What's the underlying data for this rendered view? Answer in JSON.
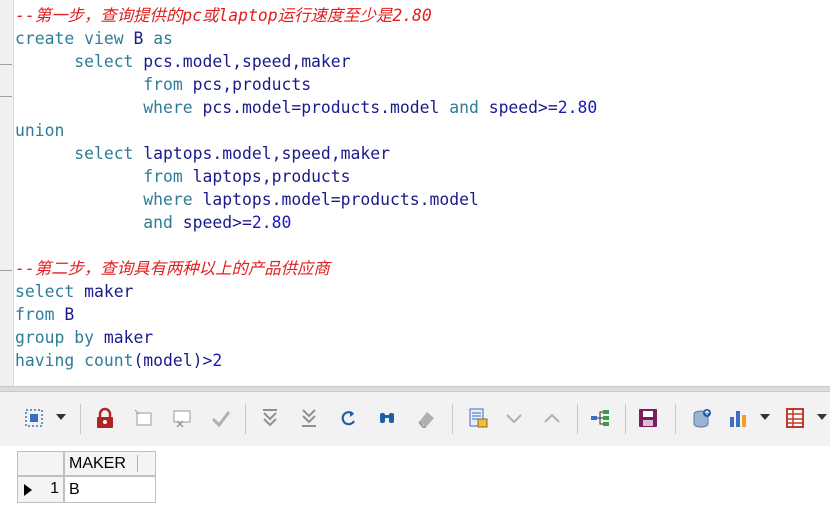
{
  "editor": {
    "lines": [
      {
        "indent": "",
        "parts": [
          {
            "t": "--第一步，查询提供的pc或laptop运行速度至少是2.80",
            "c": "cm"
          }
        ]
      },
      {
        "indent": "",
        "parts": [
          {
            "t": "create",
            "c": "kw"
          },
          {
            "t": " ",
            "c": "pl"
          },
          {
            "t": "view",
            "c": "kw"
          },
          {
            "t": " B ",
            "c": "id"
          },
          {
            "t": "as",
            "c": "kw"
          }
        ]
      },
      {
        "indent": "      ",
        "parts": [
          {
            "t": "select",
            "c": "kw"
          },
          {
            "t": " pcs.model,speed,maker",
            "c": "id"
          }
        ]
      },
      {
        "indent": "             ",
        "parts": [
          {
            "t": "from",
            "c": "kw"
          },
          {
            "t": " pcs,products",
            "c": "id"
          }
        ]
      },
      {
        "indent": "             ",
        "parts": [
          {
            "t": "where",
            "c": "kw"
          },
          {
            "t": " pcs.model=products.model ",
            "c": "id"
          },
          {
            "t": "and",
            "c": "kw"
          },
          {
            "t": " speed>=",
            "c": "id"
          },
          {
            "t": "2.80",
            "c": "num"
          }
        ]
      },
      {
        "indent": "",
        "parts": [
          {
            "t": "union",
            "c": "kw"
          }
        ]
      },
      {
        "indent": "      ",
        "parts": [
          {
            "t": "select",
            "c": "kw"
          },
          {
            "t": " laptops.model,speed,maker",
            "c": "id"
          }
        ]
      },
      {
        "indent": "             ",
        "parts": [
          {
            "t": "from",
            "c": "kw"
          },
          {
            "t": " laptops,products",
            "c": "id"
          }
        ]
      },
      {
        "indent": "             ",
        "parts": [
          {
            "t": "where",
            "c": "kw"
          },
          {
            "t": " laptops.model=products.model",
            "c": "id"
          }
        ]
      },
      {
        "indent": "             ",
        "parts": [
          {
            "t": "and",
            "c": "kw"
          },
          {
            "t": " speed>=",
            "c": "id"
          },
          {
            "t": "2.80",
            "c": "num"
          }
        ]
      },
      {
        "indent": "",
        "parts": []
      },
      {
        "indent": "",
        "parts": [
          {
            "t": "--第二步，查询具有两种以上的产品供应商",
            "c": "cm"
          }
        ]
      },
      {
        "indent": "",
        "parts": [
          {
            "t": "select",
            "c": "kw"
          },
          {
            "t": " maker",
            "c": "id"
          }
        ]
      },
      {
        "indent": "",
        "parts": [
          {
            "t": "from",
            "c": "kw"
          },
          {
            "t": " B",
            "c": "id"
          }
        ]
      },
      {
        "indent": "",
        "parts": [
          {
            "t": "group",
            "c": "kw"
          },
          {
            "t": " ",
            "c": "pl"
          },
          {
            "t": "by",
            "c": "kw"
          },
          {
            "t": " maker",
            "c": "id"
          }
        ]
      },
      {
        "indent": "",
        "parts": [
          {
            "t": "having",
            "c": "kw"
          },
          {
            "t": " ",
            "c": "pl"
          },
          {
            "t": "count",
            "c": "kw"
          },
          {
            "t": "(model)>",
            "c": "id"
          },
          {
            "t": "2",
            "c": "num"
          }
        ]
      }
    ]
  },
  "toolbar": {
    "icons": [
      "select-icon",
      "lock-icon",
      "new-record-icon",
      "delete-record-icon",
      "confirm-icon",
      "move-down-icon",
      "move-bottom-icon",
      "refresh-icon",
      "find-icon",
      "clear-icon",
      "grid-view-icon",
      "sort-desc-icon",
      "sort-asc-icon",
      "tree-icon",
      "save-icon",
      "database-icon",
      "chart-icon",
      "table-icon"
    ],
    "colors": {
      "lock": "#b22222",
      "save": "#7a1f5c",
      "refresh": "#1f5fa8",
      "chart": "#3a6fc4",
      "table": "#c0392b",
      "db": "#7a9cc4"
    }
  },
  "grid": {
    "columns": [
      "MAKER"
    ],
    "rows": [
      {
        "num": "1",
        "maker": "B"
      }
    ]
  }
}
